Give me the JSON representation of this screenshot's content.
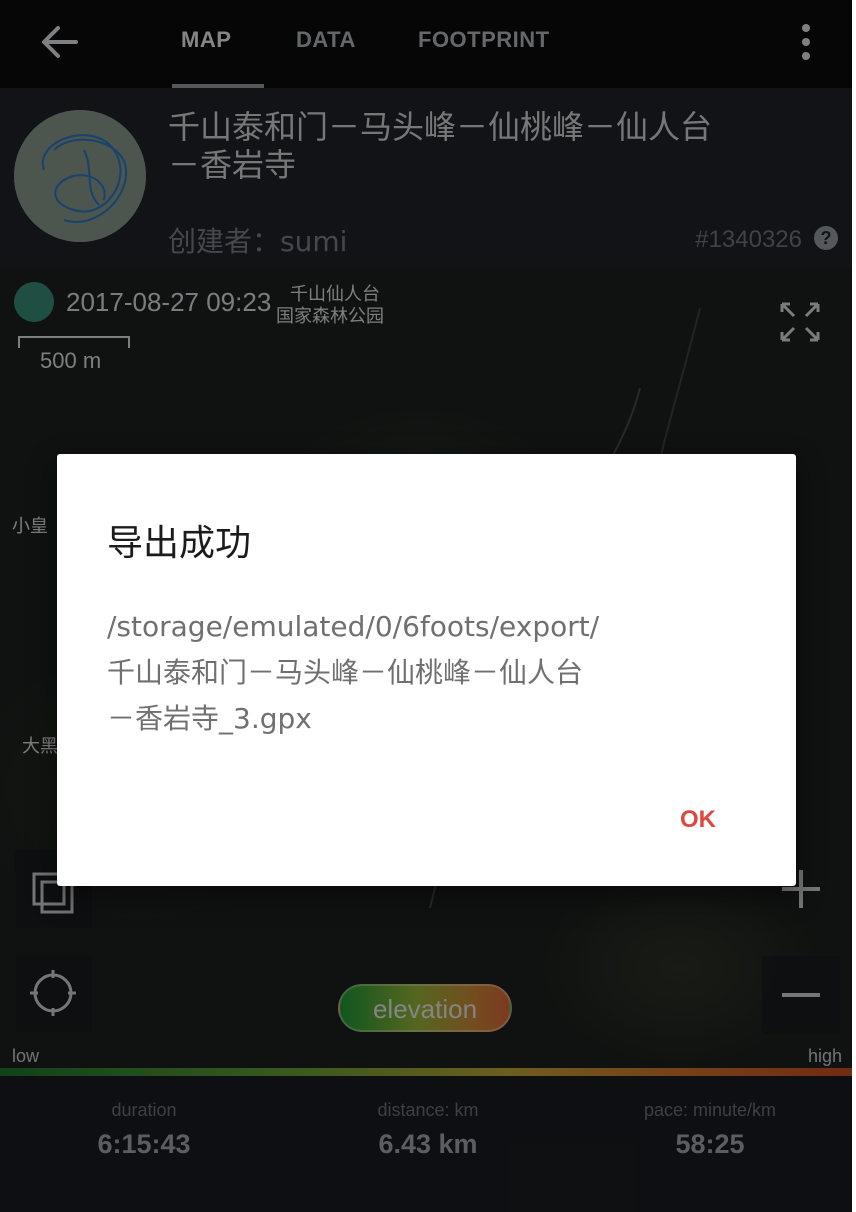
{
  "tabs": [
    "MAP",
    "DATA",
    "FOOTPRINT"
  ],
  "header": {
    "title": "千山泰和门－马头峰－仙桃峰－仙人台－香岩寺",
    "creator": "创建者：sumi",
    "record_id": "#1340326",
    "help_glyph": "?"
  },
  "map": {
    "date_time": "2017-08-27 09:23",
    "labels": [
      "千山仙人台",
      "国家森林公园",
      "小皇",
      "大黑"
    ],
    "scale": "500 m",
    "elevation_label": "elevation",
    "low_label": "low",
    "high_label": "high"
  },
  "stats": [
    {
      "label": "duration",
      "value": "6:15:43"
    },
    {
      "label": "distance: km",
      "value": "6.43 km"
    },
    {
      "label": "pace: minute/km",
      "value": "58:25"
    }
  ],
  "dialog": {
    "title": "导出成功",
    "message_lines": [
      "/storage/emulated/0/6foots/export/",
      "千山泰和门－马头峰－仙桃峰－仙人台",
      "－香岩寺_3.gpx"
    ],
    "ok_label": "OK",
    "ok_color": "#e0463d"
  },
  "icons": {
    "back": "arrow-left-icon",
    "more": "more-vertical-icon",
    "fullscreen": "fullscreen-icon",
    "layers": "layers-icon",
    "locate": "locate-icon",
    "zoom_in": "plus-icon",
    "zoom_out": "minus-icon",
    "help": "help-icon"
  }
}
